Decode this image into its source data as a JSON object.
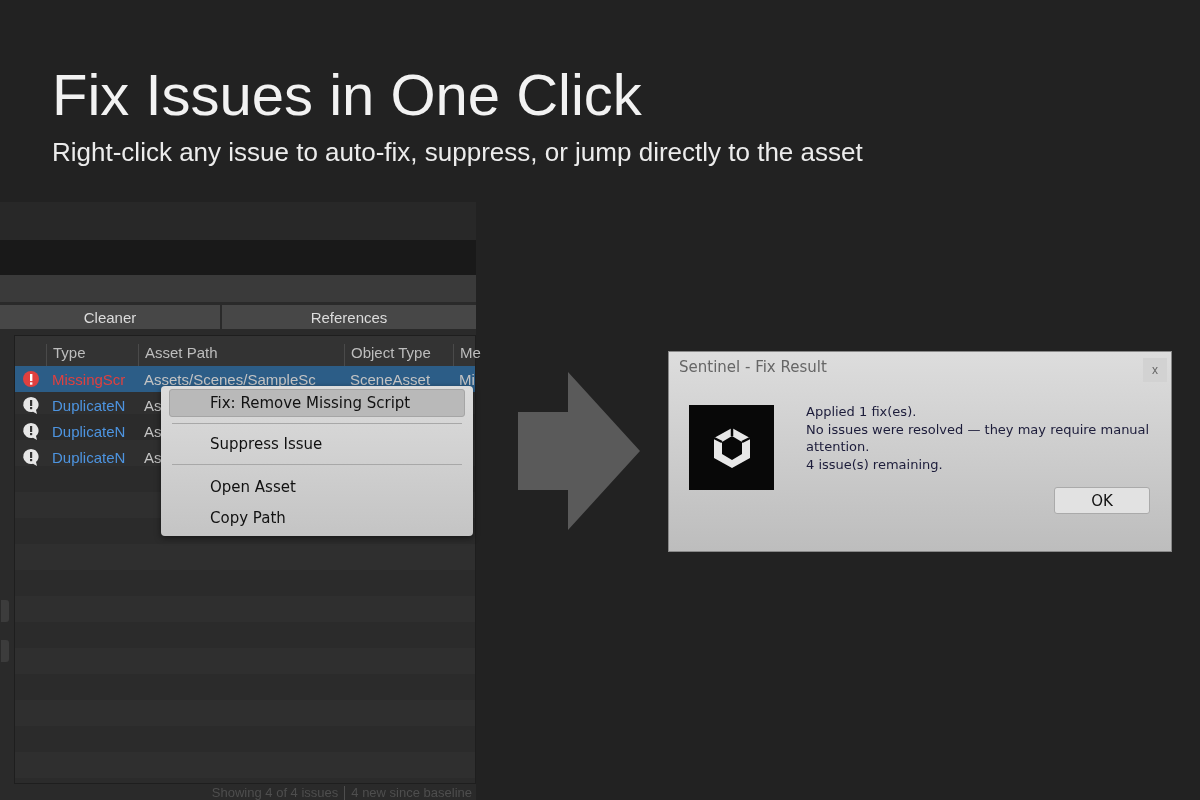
{
  "headline": "Fix Issues in One Click",
  "subheadline": "Right-click any issue to auto-fix, suppress, or jump directly to the asset",
  "editor": {
    "tabs": [
      {
        "label": "Cleaner",
        "selected": false
      },
      {
        "label": "References",
        "selected": false
      }
    ],
    "table": {
      "columns": [
        "Type",
        "Asset Path",
        "Object Type",
        "Me"
      ],
      "rows": [
        {
          "kind": "error",
          "selected": true,
          "cells": [
            "MissingScr",
            "Assets/Scenes/SampleSc",
            "SceneAsset",
            "Mi"
          ]
        },
        {
          "kind": "warning",
          "selected": false,
          "cells": [
            "DuplicateN",
            "As"
          ]
        },
        {
          "kind": "warning",
          "selected": false,
          "cells": [
            "DuplicateN",
            "As"
          ]
        },
        {
          "kind": "warning",
          "selected": false,
          "cells": [
            "DuplicateN",
            "As"
          ]
        }
      ]
    },
    "context_menu": [
      [
        {
          "label": "Fix: Remove Missing Script",
          "selected": true
        }
      ],
      [
        {
          "label": "Suppress Issue",
          "selected": false
        }
      ],
      [
        {
          "label": "Open Asset",
          "selected": false
        },
        {
          "label": "Copy Path",
          "selected": false
        }
      ]
    ],
    "status": [
      "Showing 4 of 4 issues",
      "4 new since baseline"
    ]
  },
  "dialog": {
    "title": "Sentinel - Fix Result",
    "close": "x",
    "message": [
      "Applied 1 fix(es).",
      "No issues were resolved — they may require manual attention.",
      "4 issue(s) remaining."
    ],
    "button": "OK"
  }
}
